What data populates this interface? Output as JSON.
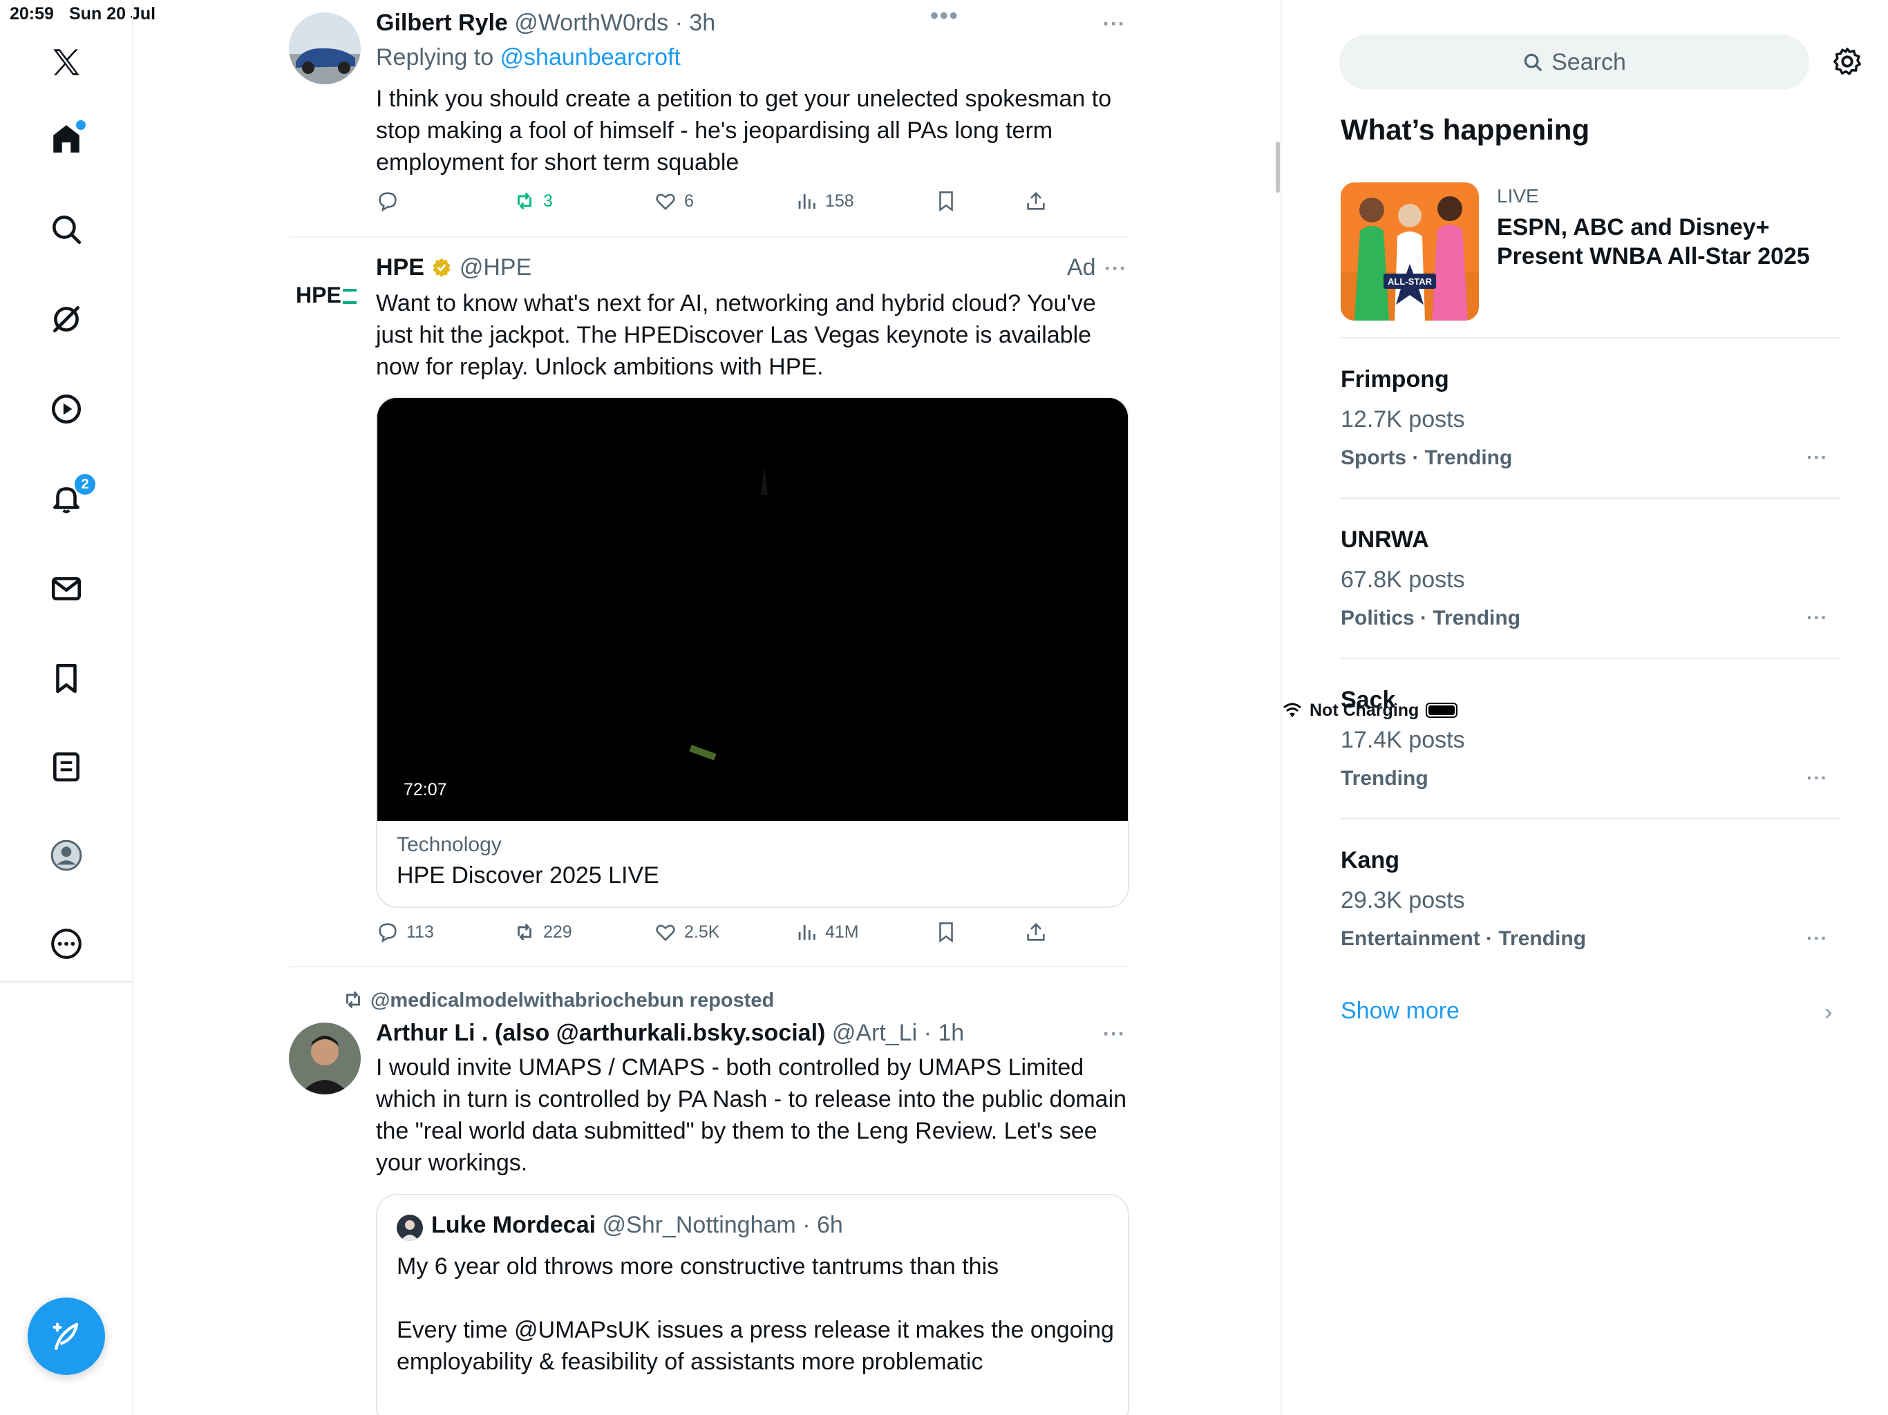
{
  "status": {
    "time": "20:59",
    "date": "Sun 20 Jul",
    "charging": "Not Charging"
  },
  "nav": {
    "notifications_badge": "2",
    "icons": [
      "x-logo-icon",
      "home-icon",
      "search-icon",
      "grok-icon",
      "video-icon",
      "bell-icon",
      "mail-icon",
      "bookmark-icon",
      "list-icon",
      "profile-icon",
      "more-icon"
    ]
  },
  "tweets": [
    {
      "name": "Gilbert Ryle",
      "handle": "@WorthW0rds",
      "time": "· 3h",
      "replying_prefix": "Replying to ",
      "replying_to": "@shaunbearcroft",
      "text": "I think you should create a petition to get your unelected spokesman to stop making a fool of himself - he's jeopardising all PAs long term employment for short term squable",
      "reposts": "3",
      "likes": "6",
      "views": "158"
    },
    {
      "name": "HPE",
      "handle": "@HPE",
      "ad": "Ad",
      "logo": "HPE",
      "text": "Want to know what's next for AI, networking and hybrid cloud? You've just hit the jackpot. The HPEDiscover Las Vegas keynote is available now for replay. Unlock ambitions with HPE.",
      "duration": "72:07",
      "card_category": "Technology",
      "card_title": "HPE Discover 2025 LIVE",
      "replies": "113",
      "reposts": "229",
      "likes": "2.5K",
      "views": "41M"
    },
    {
      "reposted_by": "@medicalmodelwithabriochebun reposted",
      "name": "Arthur Li . (also @arthurkali.bsky.social)",
      "handle": "@Art_Li",
      "time": "· 1h",
      "text": "I would invite UMAPS / CMAPS - both controlled by UMAPS Limited which in turn is controlled by PA Nash - to release into the public domain the \"real world data submitted\" by them to the Leng Review. Let's see your workings.",
      "quote": {
        "name": "Luke Mordecai",
        "handle": "@Shr_Nottingham",
        "time": "· 6h",
        "line1": "My 6 year old throws more constructive tantrums than this",
        "line2": "Every time @UMAPsUK issues a press release it makes the ongoing employability & feasibility of assistants more problematic"
      }
    }
  ],
  "right": {
    "search_placeholder": "Search",
    "title": "What’s happening",
    "live": {
      "label": "LIVE",
      "title": "ESPN, ABC and Disney+ Present WNBA All-Star 2025",
      "image_text": "ALL-STAR"
    },
    "trends": [
      {
        "name": "Frimpong",
        "count": "12.7K posts",
        "category": "Sports · Trending"
      },
      {
        "name": "UNRWA",
        "count": "67.8K posts",
        "category": "Politics · Trending"
      },
      {
        "name": "Sack",
        "count": "17.4K posts",
        "category": "Trending"
      },
      {
        "name": "Kang",
        "count": "29.3K posts",
        "category": "Entertainment · Trending"
      }
    ],
    "show_more": "Show more"
  },
  "colors": {
    "accent": "#1d9bf0",
    "repost_green": "#00ba7c",
    "muted": "#536471",
    "verified_gold": "#e2b719"
  }
}
